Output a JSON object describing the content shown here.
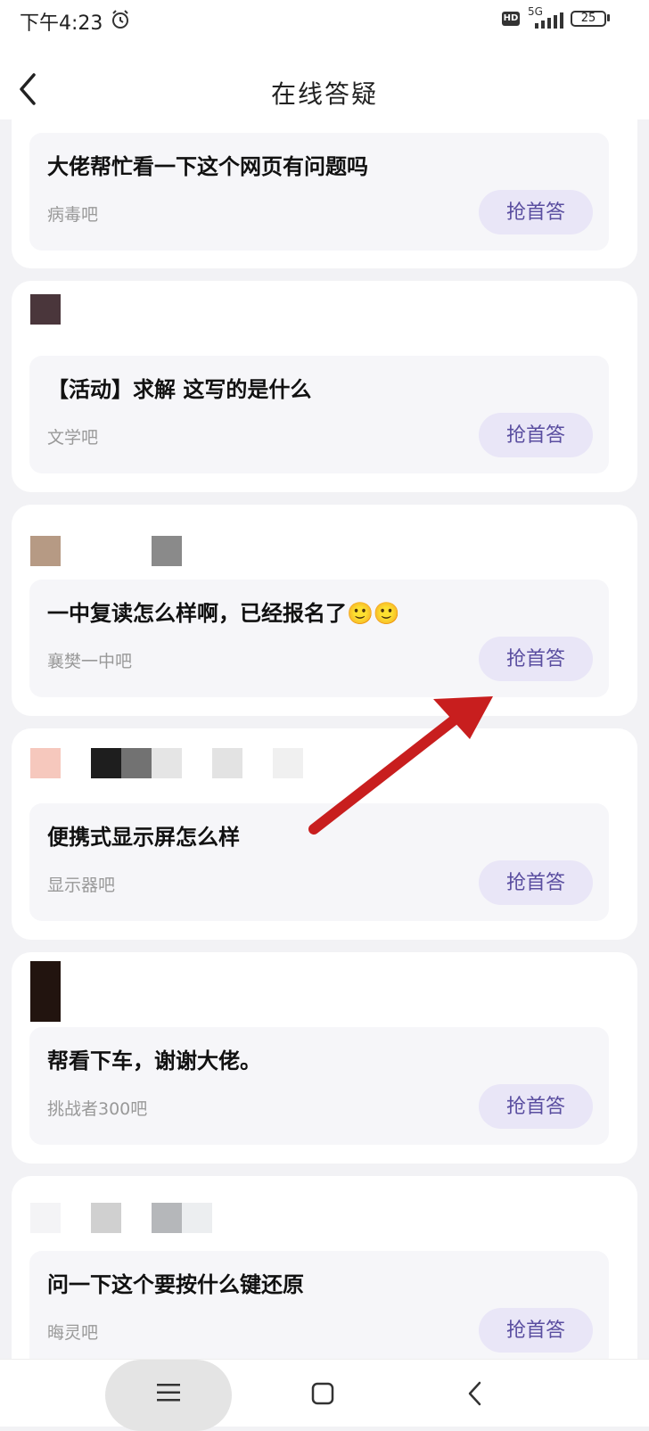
{
  "status_bar": {
    "time": "下午4:23",
    "network": "5G",
    "battery": "25",
    "icons": [
      "alarm-icon",
      "hd-icon",
      "signal-icon",
      "battery-icon"
    ]
  },
  "header": {
    "title": "在线答疑",
    "back_icon": "chevron-left-icon"
  },
  "answer_label": "抢首答",
  "questions": [
    {
      "title": "大佬帮忙看一下这个网页有问题吗",
      "forum": "病毒吧"
    },
    {
      "title": "【活动】求解 这写的是什么",
      "forum": "文学吧"
    },
    {
      "title": "一中复读怎么样啊，已经报名了🙂🙂",
      "forum": "襄樊一中吧"
    },
    {
      "title": "便携式显示屏怎么样",
      "forum": "显示器吧"
    },
    {
      "title": "帮看下车，谢谢大佬。",
      "forum": "挑战者300吧"
    },
    {
      "title": "问一下这个要按什么键还原",
      "forum": "晦灵吧"
    }
  ],
  "nav_bar": {
    "icons": [
      "menu-icon",
      "home-icon",
      "back-icon"
    ]
  },
  "annotation": {
    "color": "#c81e1e"
  }
}
